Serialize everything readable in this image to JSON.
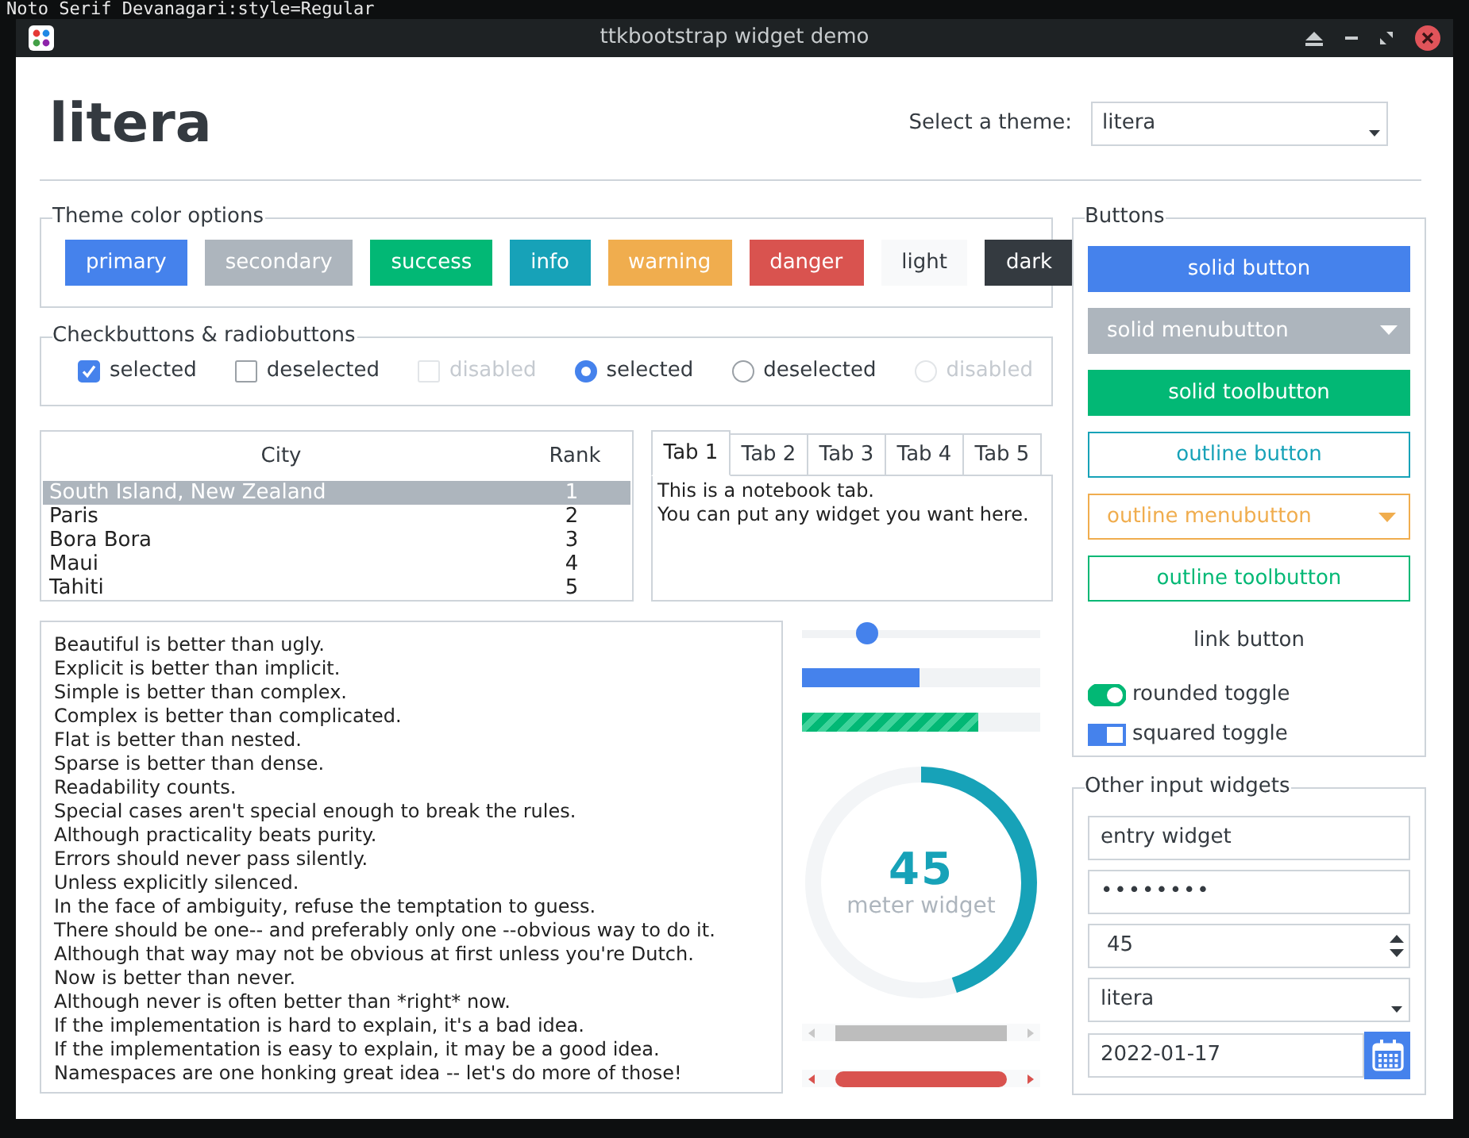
{
  "terminal": {
    "line": "Noto Serif Devanagari:style=Regular"
  },
  "window": {
    "title": "ttkbootstrap widget demo"
  },
  "header": {
    "title": "litera",
    "theme_label": "Select a theme:",
    "theme_value": "litera"
  },
  "theme_colors": {
    "title": "Theme color options",
    "buttons": [
      {
        "label": "primary",
        "color": "#4582ec"
      },
      {
        "label": "secondary",
        "color": "#adb5bd"
      },
      {
        "label": "success",
        "color": "#02b875"
      },
      {
        "label": "info",
        "color": "#17a2b8"
      },
      {
        "label": "warning",
        "color": "#f0ad4e"
      },
      {
        "label": "danger",
        "color": "#d9534f"
      },
      {
        "label": "light",
        "color": "#f8f9fa"
      },
      {
        "label": "dark",
        "color": "#343a40"
      }
    ]
  },
  "checks": {
    "title": "Checkbuttons & radiobuttons",
    "items": [
      {
        "kind": "checkbox",
        "label": "selected",
        "checked": true,
        "disabled": false
      },
      {
        "kind": "checkbox",
        "label": "deselected",
        "checked": false,
        "disabled": false
      },
      {
        "kind": "checkbox",
        "label": "disabled",
        "checked": false,
        "disabled": true
      },
      {
        "kind": "radio",
        "label": "selected",
        "selected": true,
        "disabled": false
      },
      {
        "kind": "radio",
        "label": "deselected",
        "selected": false,
        "disabled": false
      },
      {
        "kind": "radio",
        "label": "disabled",
        "selected": false,
        "disabled": true
      }
    ]
  },
  "table": {
    "columns": [
      "City",
      "Rank"
    ],
    "rows": [
      {
        "city": "South Island, New Zealand",
        "rank": "1",
        "selected": true
      },
      {
        "city": "Paris",
        "rank": "2",
        "selected": false
      },
      {
        "city": "Bora Bora",
        "rank": "3",
        "selected": false
      },
      {
        "city": "Maui",
        "rank": "4",
        "selected": false
      },
      {
        "city": "Tahiti",
        "rank": "5",
        "selected": false
      }
    ]
  },
  "notebook": {
    "tabs": [
      {
        "label": "Tab 1",
        "selected": true
      },
      {
        "label": "Tab 2",
        "selected": false
      },
      {
        "label": "Tab 3",
        "selected": false
      },
      {
        "label": "Tab 4",
        "selected": false
      },
      {
        "label": "Tab 5",
        "selected": false
      }
    ],
    "content": [
      "This is a notebook tab.",
      "You can put any widget you want here."
    ]
  },
  "text_lines": [
    "Beautiful is better than ugly.",
    "Explicit is better than implicit.",
    "Simple is better than complex.",
    "Complex is better than complicated.",
    "Flat is better than nested.",
    "Sparse is better than dense.",
    "Readability counts.",
    "Special cases aren't special enough to break the rules.",
    "Although practicality beats purity.",
    "Errors should never pass silently.",
    "Unless explicitly silenced.",
    "In the face of ambiguity, refuse the temptation to guess.",
    "There should be one-- and preferably only one --obvious way to do it.",
    "Although that way may not be obvious at first unless you're Dutch.",
    "Now is better than never.",
    "Although never is often better than *right* now.",
    "If the implementation is hard to explain, it's a bad idea.",
    "If the implementation is easy to explain, it may be a good idea.",
    "Namespaces are one honking great idea -- let's do more of those!"
  ],
  "scale": {
    "level": 0.27
  },
  "progress": [
    {
      "kind": "plain",
      "level": 0.49,
      "color": "#4582ec"
    },
    {
      "kind": "striped",
      "level": 0.74,
      "color": "#02b875"
    }
  ],
  "meter": {
    "value": "45",
    "label": "meter widget",
    "level": 0.45
  },
  "buttons_panel": {
    "title": "Buttons",
    "buttons": [
      {
        "kind": "solid",
        "label": "solid button",
        "color": "#4582ec"
      },
      {
        "kind": "solid-menu",
        "label": "solid menubutton",
        "color": "#adb5bd"
      },
      {
        "kind": "solid",
        "label": "solid toolbutton",
        "color": "#02b875"
      },
      {
        "kind": "outline",
        "label": "outline button",
        "color": "#17a2b8"
      },
      {
        "kind": "outline-menu",
        "label": "outline menubutton",
        "color": "#f0ad4e"
      },
      {
        "kind": "outline",
        "label": "outline toolbutton",
        "color": "#02b875"
      },
      {
        "kind": "link",
        "label": "link button"
      }
    ],
    "toggles": [
      {
        "kind": "round",
        "label": "rounded toggle",
        "on": true,
        "color": "#02b875"
      },
      {
        "kind": "square",
        "label": "squared toggle",
        "on": true,
        "color": "#4582ec"
      }
    ]
  },
  "inputs": {
    "title": "Other input widgets",
    "entry": "entry widget",
    "password": "••••••••",
    "spinbox": "45",
    "combobox": "litera",
    "date": "2022-01-17"
  }
}
